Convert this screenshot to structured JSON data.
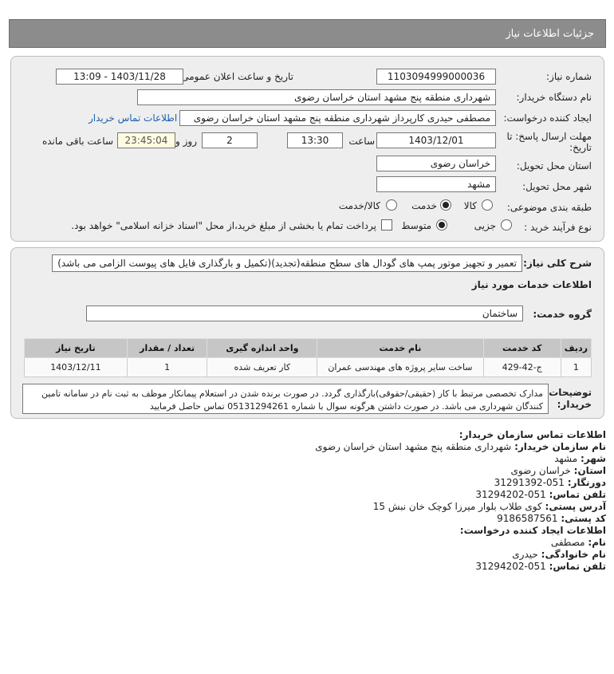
{
  "header": {
    "title": "جزئیات اطلاعات نیاز"
  },
  "form": {
    "need_number_label": "شماره نیاز:",
    "need_number": "1103094999000036",
    "announce_label": "تاریخ و ساعت اعلان عمومی:",
    "announce_value": "1403/11/28 - 13:09",
    "buyer_label": "نام دستگاه خریدار:",
    "buyer_value": "شهرداری منطقه پنج مشهد استان خراسان رضوی",
    "creator_label": "ایجاد کننده درخواست:",
    "creator_value": "مصطفی حیدری کارپرداز شهرداری منطقه پنج مشهد استان خراسان رضوی",
    "contact_link": "اطلاعات تماس خریدار",
    "deadline_label": "مهلت ارسال پاسخ: تا تاریخ:",
    "deadline_date": "1403/12/01",
    "time_label": "ساعت",
    "deadline_time": "13:30",
    "days_value": "2",
    "days_label": "روز و",
    "remaining_value": "23:45:04",
    "remaining_label": "ساعت باقی مانده",
    "province_label": "استان محل تحویل:",
    "province_value": "خراسان رضوی",
    "city_label": "شهر محل تحویل:",
    "city_value": "مشهد",
    "category_label": "طبقه بندی موضوعی:",
    "category_options": [
      "کالا",
      "خدمت",
      "کالا/خدمت"
    ],
    "process_label": "نوع فرآیند خرید :",
    "process_options": [
      "جزیی",
      "متوسط"
    ],
    "payment_note": "پرداخت تمام یا بخشی از مبلغ خرید،از محل \"اسناد خزانه اسلامی\" خواهد بود."
  },
  "details": {
    "summary_label": "شرح کلی نیاز:",
    "summary_value": "تعمیر و تجهیز موتور پمپ های گودال های سطح منطقه(تجدید)(تکمیل و بارگذاری فایل های پیوست الزامی می باشد)",
    "services_heading": "اطلاعات خدمات مورد نیاز",
    "service_group_label": "گروه خدمت:",
    "service_group_value": "ساختمان",
    "table": {
      "headers": [
        "ردیف",
        "کد خدمت",
        "نام خدمت",
        "واحد اندازه گیری",
        "تعداد / مقدار",
        "تاریخ نیاز"
      ],
      "rows": [
        [
          "1",
          "ج-42-429",
          "ساخت سایر پروژه های مهندسی عمران",
          "کار تعریف شده",
          "1",
          "1403/12/11"
        ]
      ]
    },
    "buyer_notes_label": "توضیحات خریدار:",
    "buyer_notes": "مدارک تخصصی مرتبط با کار (حقیقی/حقوقی)بارگذاری گردد. در صورت برنده شدن در استعلام پیمانکار موظف به ثبت نام در سامانه تامین کنندگان شهرداری می باشد. در صورت داشتن هرگونه سوال با شماره 05131294261 تماس حاصل فرمایید"
  },
  "contact": {
    "org_heading": "اطلاعات تماس سازمان خریدار:",
    "org_name_label": "نام سازمان خریدار:",
    "org_name": "شهرداری منطقه پنج مشهد استان خراسان رضوی",
    "city_label": "شهر:",
    "city": "مشهد",
    "province_label": "استان:",
    "province": "خراسان رضوی",
    "fax_label": "دورنگار:",
    "fax": "051-31291392",
    "phone_label": "تلفن تماس:",
    "phone": "051-31294202",
    "address_label": "آدرس پستی:",
    "address": "کوی طلاب بلوار میرزا کوچک خان نبش 15",
    "postal_label": "کد پستی:",
    "postal": "9186587561",
    "creator_heading": "اطلاعات ایجاد کننده درخواست:",
    "first_name_label": "نام:",
    "first_name": "مصطفی",
    "last_name_label": "نام خانوادگی:",
    "last_name": "حیدری",
    "creator_phone_label": "تلفن تماس:",
    "creator_phone": "051-31294202"
  }
}
